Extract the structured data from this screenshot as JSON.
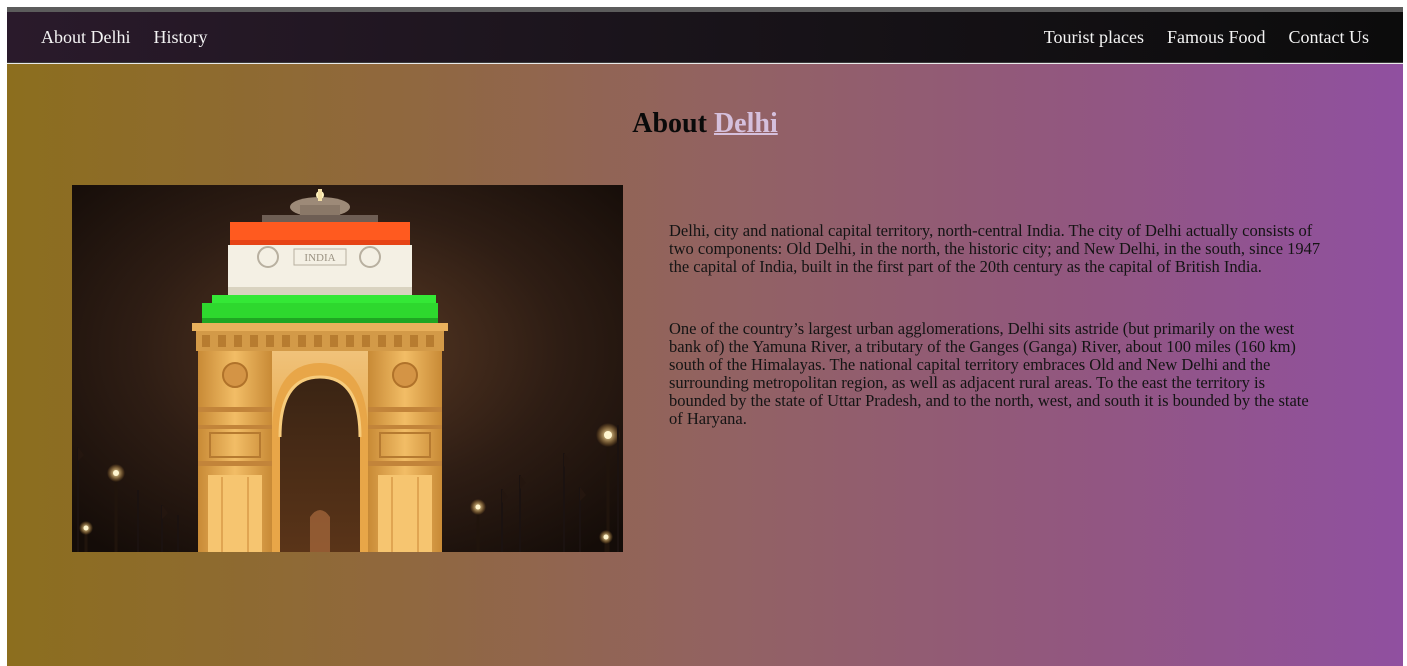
{
  "nav": {
    "left": [
      {
        "label": "About Delhi"
      },
      {
        "label": "History"
      }
    ],
    "right": [
      {
        "label": "Tourist places"
      },
      {
        "label": "Famous Food"
      },
      {
        "label": "Contact Us"
      }
    ]
  },
  "title": {
    "prefix": "About",
    "accent": "Delhi"
  },
  "image": {
    "subject": "india-gate-night",
    "inscription": "INDIA"
  },
  "paragraphs": [
    "Delhi, city and national capital territory, north-central India. The city of Delhi actually consists of two components: Old Delhi, in the north, the historic city; and New Delhi, in the south, since 1947 the capital of India, built in the first part of the 20th century as the capital of British India.",
    "One of the country’s largest urban agglomerations, Delhi sits astride (but primarily on the west bank of) the Yamuna River, a tributary of the Ganges (Ganga) River, about 100 miles (160 km) south of the Himalayas. The national capital territory embraces Old and New Delhi and the surrounding metropolitan region, as well as adjacent rural areas. To the east the territory is bounded by the state of Uttar Pradesh, and to the north, west, and south it is bounded by the state of Haryana."
  ],
  "colors": {
    "nav_bg_start": "#2a1a2b",
    "nav_bg_end": "#0c0c0c",
    "gradient_start": "#8c6e1e",
    "gradient_end": "#9050a0",
    "title_accent": "#d5c0dd",
    "flag_saffron": "#ff5a1f",
    "flag_white": "#f4f0e4",
    "flag_green": "#2ee02e"
  }
}
